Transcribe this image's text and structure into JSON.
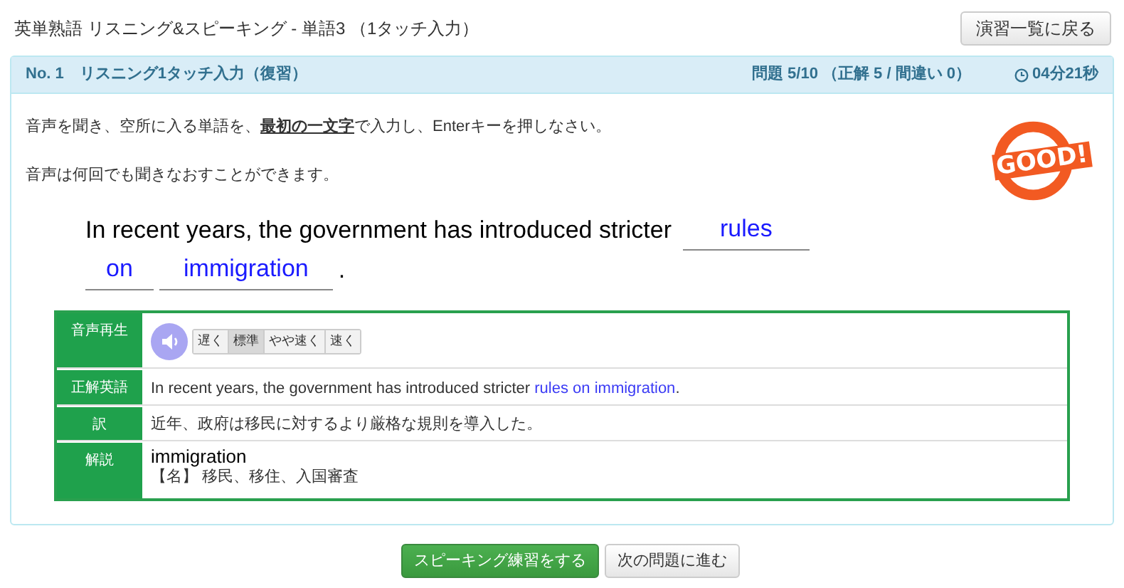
{
  "page_title": "英単熟語 リスニング&スピーキング - 単語3 （1タッチ入力）",
  "back_button": "演習一覧に戻る",
  "panel": {
    "title": "No. 1　リスニング1タッチ入力（復習）",
    "progress": "問題 5/10 （正解 5 / 間違い 0）",
    "timer": "04分21秒"
  },
  "instructions": [
    "音声を聞き、空所に入る単語を、**最初の一文字**で入力し、Enterキーを押しなさい。",
    "音声は何回でも聞きなおすことができます。"
  ],
  "stamp": "GOOD!",
  "sentence": [
    {
      "kind": "text",
      "text": "In recent years, the government has introduced stricter"
    },
    {
      "kind": "blank",
      "text": "rules"
    },
    {
      "kind": "blank",
      "text": "on"
    },
    {
      "kind": "blank",
      "text": "immigration"
    },
    {
      "kind": "text",
      "text": "."
    }
  ],
  "details": [
    {
      "kind": "audio",
      "label": "音声再生",
      "speeds": [
        {
          "label": "遅く",
          "selected": false
        },
        {
          "label": "標準",
          "selected": true
        },
        {
          "label": "やや速く",
          "selected": false
        },
        {
          "label": "速く",
          "selected": false
        }
      ]
    },
    {
      "kind": "answer",
      "label": "正解英語",
      "parts": [
        {
          "kind": "text",
          "text": "In recent years, the government has introduced stricter "
        },
        {
          "kind": "answer",
          "text": "rules on immigration"
        },
        {
          "kind": "text",
          "text": "."
        }
      ]
    },
    {
      "kind": "text",
      "label": "訳",
      "lines": [
        "近年、政府は移民に対するより厳格な規則を導入した。"
      ]
    },
    {
      "kind": "word",
      "label": "解説",
      "word": "immigration",
      "lines": [
        "【名】 移民、移住、入国審査"
      ]
    }
  ],
  "buttons": [
    {
      "kind": "primary",
      "label": "スピーキング練習をする"
    },
    {
      "kind": "secondary",
      "label": "次の問題に進む"
    }
  ]
}
